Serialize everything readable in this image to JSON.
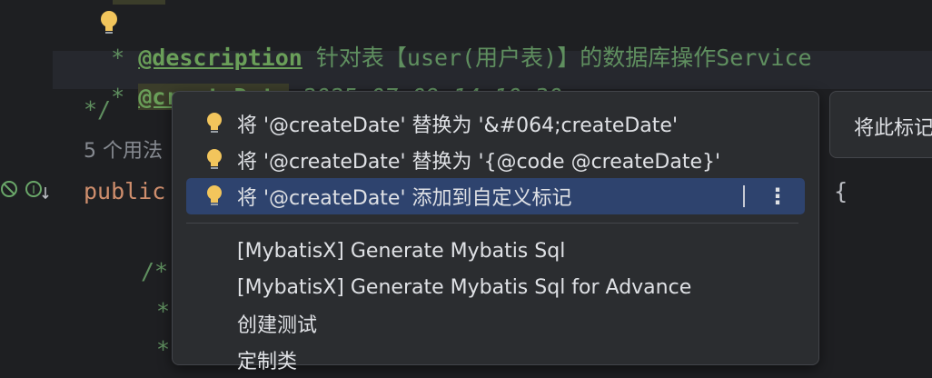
{
  "editor": {
    "line_description": {
      "star": "* ",
      "tag": "@description",
      "text": " 针对表【user(用户表)】的数据库操作Service"
    },
    "line_createDate": {
      "star": "* ",
      "tag": "@createDate",
      "text": " 2025-07-09 14:10:30"
    },
    "line_end_comment": "*/",
    "usages": "5 个用法",
    "line_public": "public",
    "line_brace": "› {",
    "line_comment_open": "/*",
    "line_star1": "*",
    "line_star2": "*"
  },
  "intention_popup": {
    "items": [
      {
        "label": "将 '@createDate' 替换为 '&#064;createDate'",
        "icon": "lightbulb-icon"
      },
      {
        "label": "将 '@createDate' 替换为 '{@code @createDate}'",
        "icon": "lightbulb-icon"
      },
      {
        "label": "将 '@createDate' 添加到自定义标记",
        "icon": "lightbulb-icon",
        "selected": true,
        "more": "⋮"
      }
    ],
    "secondary_items": [
      {
        "label": "[MybatisX] Generate Mybatis Sql"
      },
      {
        "label": "[MybatisX] Generate Mybatis Sql for Advance"
      },
      {
        "label": "创建测试"
      },
      {
        "label": "定制类"
      }
    ]
  },
  "side_popup": {
    "label": "将此标记"
  },
  "colors": {
    "selection": "#2e436e",
    "bulb": "#f2c55c",
    "comment": "#5f8f5f",
    "keyword": "#cf8e6d"
  }
}
